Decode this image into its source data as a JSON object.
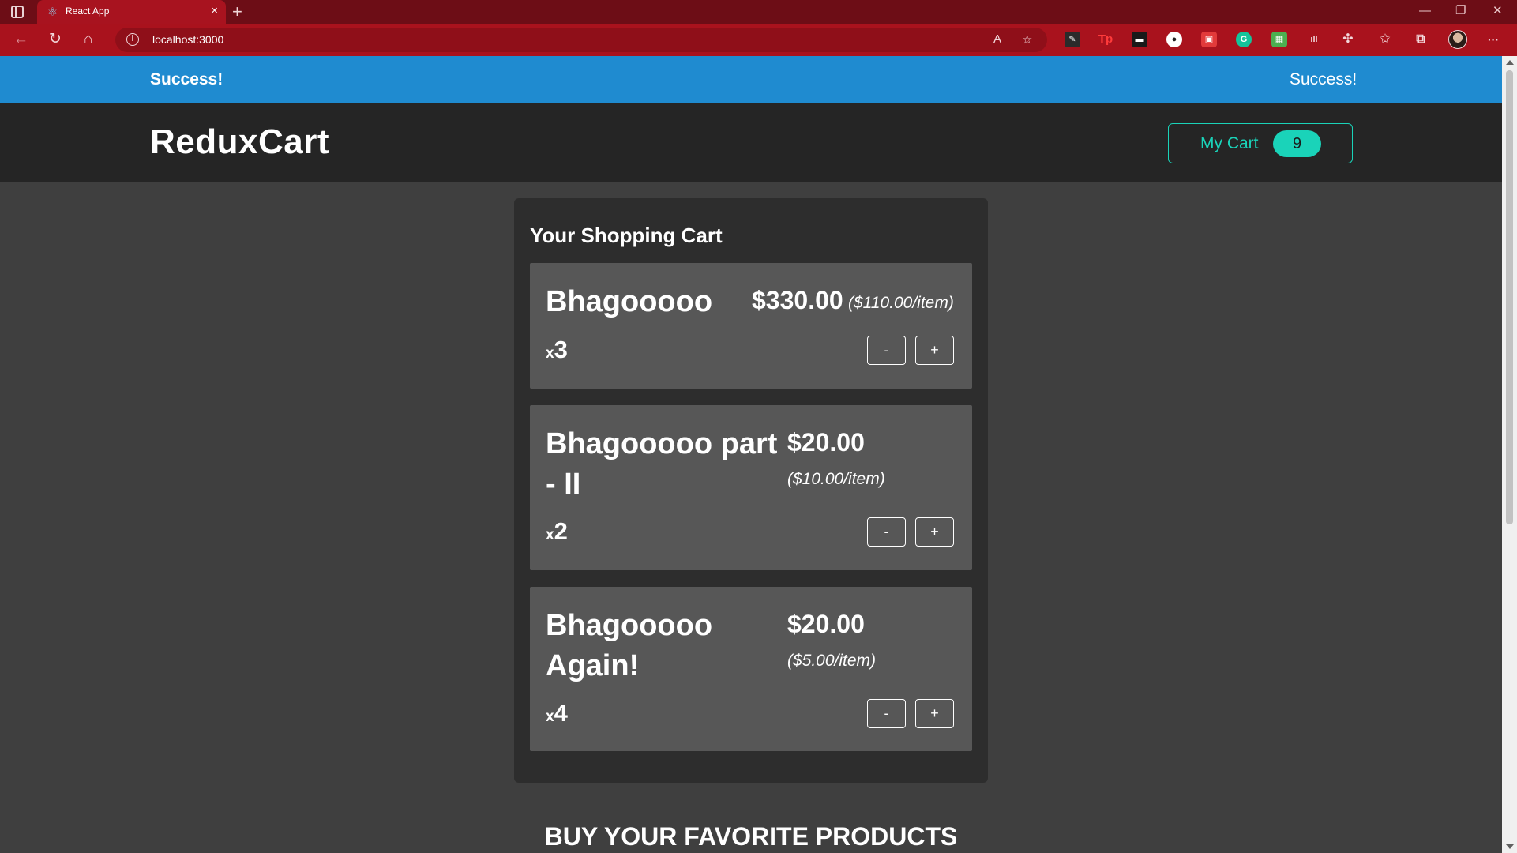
{
  "browser": {
    "tab_title": "React App",
    "tab_close": "×",
    "new_tab": "+",
    "url": "localhost:3000",
    "minimize": "—",
    "restore": "❐",
    "close": "✕",
    "more": "···"
  },
  "notification": {
    "title": "Success!",
    "message": "Success!",
    "color": "#1f8bd0"
  },
  "header": {
    "logo": "ReduxCart",
    "cart_button_label": "My Cart",
    "cart_badge_count": "9",
    "accent_color": "#1ad3b9"
  },
  "cart": {
    "title": "Your Shopping Cart",
    "items": [
      {
        "name": "Bhagooooo",
        "total": "$330.00",
        "unit_price": "($110.00/item)",
        "qty_prefix": "x",
        "quantity": "3",
        "decrement": "-",
        "increment": "+"
      },
      {
        "name": "Bhagooooo part - II",
        "total": "$20.00",
        "unit_price": "($10.00/item)",
        "qty_prefix": "x",
        "quantity": "2",
        "decrement": "-",
        "increment": "+"
      },
      {
        "name": "Bhagooooo Again!",
        "total": "$20.00",
        "unit_price": "($5.00/item)",
        "qty_prefix": "x",
        "quantity": "4",
        "decrement": "-",
        "increment": "+"
      }
    ]
  },
  "products": {
    "heading": "BUY YOUR FAVORITE PRODUCTS"
  }
}
